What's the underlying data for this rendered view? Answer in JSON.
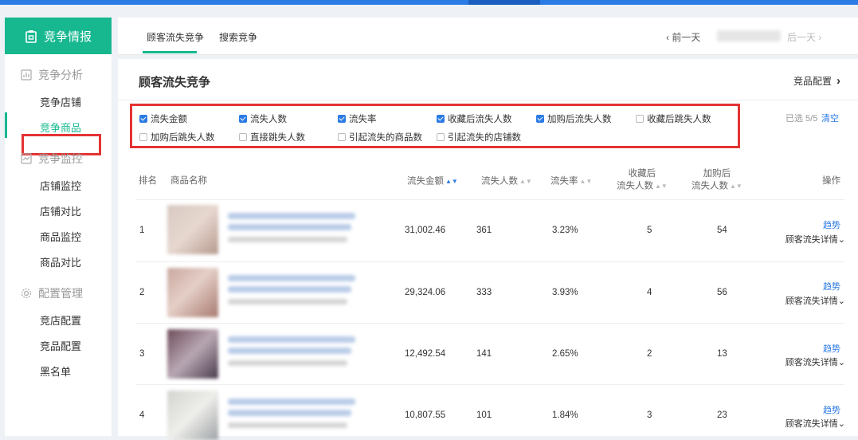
{
  "sidebar": {
    "header": "竞争情报",
    "groups": [
      {
        "label": "竞争分析",
        "items": [
          "竞争店铺",
          "竞争商品"
        ]
      },
      {
        "label": "竞争监控",
        "items": [
          "店铺监控",
          "店铺对比",
          "商品监控",
          "商品对比"
        ]
      },
      {
        "label": "配置管理",
        "items": [
          "竞店配置",
          "竞品配置",
          "黑名单"
        ]
      }
    ],
    "active_item": "竞争商品"
  },
  "tabs": {
    "items": [
      "顾客流失竞争",
      "搜索竞争"
    ],
    "active": "顾客流失竞争",
    "prev_day": "前一天",
    "next_day": "后一天"
  },
  "panel": {
    "title": "顾客流失竞争",
    "config_link": "竞品配置",
    "selected": "已选 5/5",
    "clear": "清空"
  },
  "filters": [
    {
      "label": "流失金额",
      "checked": true
    },
    {
      "label": "流失人数",
      "checked": true
    },
    {
      "label": "流失率",
      "checked": true
    },
    {
      "label": "收藏后流失人数",
      "checked": true
    },
    {
      "label": "加购后流失人数",
      "checked": true
    },
    {
      "label": "收藏后跳失人数",
      "checked": false
    },
    {
      "label": "加购后跳失人数",
      "checked": false
    },
    {
      "label": "直接跳失人数",
      "checked": false
    },
    {
      "label": "引起流失的商品数",
      "checked": false
    },
    {
      "label": "引起流失的店铺数",
      "checked": false
    }
  ],
  "table": {
    "headers": {
      "rank": "排名",
      "name": "商品名称",
      "amount": "流失金额",
      "count": "流失人数",
      "rate": "流失率",
      "fav_1": "收藏后",
      "fav_2": "流失人数",
      "cart_1": "加购后",
      "cart_2": "流失人数",
      "op": "操作"
    },
    "rows": [
      {
        "rank": "1",
        "amount": "31,002.46",
        "count": "361",
        "rate": "3.23%",
        "fav": "5",
        "cart": "54",
        "trend": "趋势",
        "detail": "顾客流失详情"
      },
      {
        "rank": "2",
        "amount": "29,324.06",
        "count": "333",
        "rate": "3.93%",
        "fav": "4",
        "cart": "56",
        "trend": "趋势",
        "detail": "顾客流失详情"
      },
      {
        "rank": "3",
        "amount": "12,492.54",
        "count": "141",
        "rate": "2.65%",
        "fav": "2",
        "cart": "13",
        "trend": "趋势",
        "detail": "顾客流失详情"
      },
      {
        "rank": "4",
        "amount": "10,807.55",
        "count": "101",
        "rate": "1.84%",
        "fav": "3",
        "cart": "23",
        "trend": "趋势",
        "detail": "顾客流失详情"
      }
    ]
  },
  "colors": {
    "brand": "#17b890",
    "link": "#2c7be5",
    "highlight": "#e53333"
  }
}
